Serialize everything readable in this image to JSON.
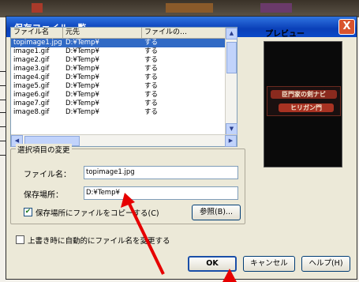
{
  "dialog": {
    "title": "保存ファイル一覧",
    "close_glyph": "X"
  },
  "list": {
    "columns": [
      "ファイル名",
      "元先",
      "ファイルの…"
    ],
    "rows": [
      {
        "name": "topimage1.jpg",
        "path": "D:¥Temp¥",
        "status": "する"
      },
      {
        "name": "image1.gif",
        "path": "D:¥Temp¥",
        "status": "する"
      },
      {
        "name": "image2.gif",
        "path": "D:¥Temp¥",
        "status": "する"
      },
      {
        "name": "image3.gif",
        "path": "D:¥Temp¥",
        "status": "する"
      },
      {
        "name": "image4.gif",
        "path": "D:¥Temp¥",
        "status": "する"
      },
      {
        "name": "image5.gif",
        "path": "D:¥Temp¥",
        "status": "する"
      },
      {
        "name": "image6.gif",
        "path": "D:¥Temp¥",
        "status": "する"
      },
      {
        "name": "image7.gif",
        "path": "D:¥Temp¥",
        "status": "する"
      },
      {
        "name": "image8.gif",
        "path": "D:¥Temp¥",
        "status": "する"
      }
    ],
    "selected_index": 0
  },
  "preview": {
    "label": "プレビュー",
    "image_line1": "臣門家の剣ナビ",
    "image_line2": "ヒリガン門"
  },
  "change_group": {
    "title": "選択項目の変更",
    "filename_label": "ファイル名：",
    "filename_value": "topimage1.jpg",
    "location_label": "保存場所：",
    "location_value": "D:¥Temp¥",
    "copy_checkbox_label": "保存場所にファイルをコピーする(C)",
    "copy_checked": true,
    "browse_label": "参照(B)..."
  },
  "overwrite": {
    "label": "上書き時に自動的にファイル名を変更する",
    "checked": false
  },
  "buttons": {
    "ok": "OK",
    "cancel": "キャンセル",
    "help": "ヘルプ(H)"
  },
  "colors": {
    "titlebar": "#0a3fb8",
    "selection": "#316ac5",
    "annotation_arrow": "#e60000"
  }
}
